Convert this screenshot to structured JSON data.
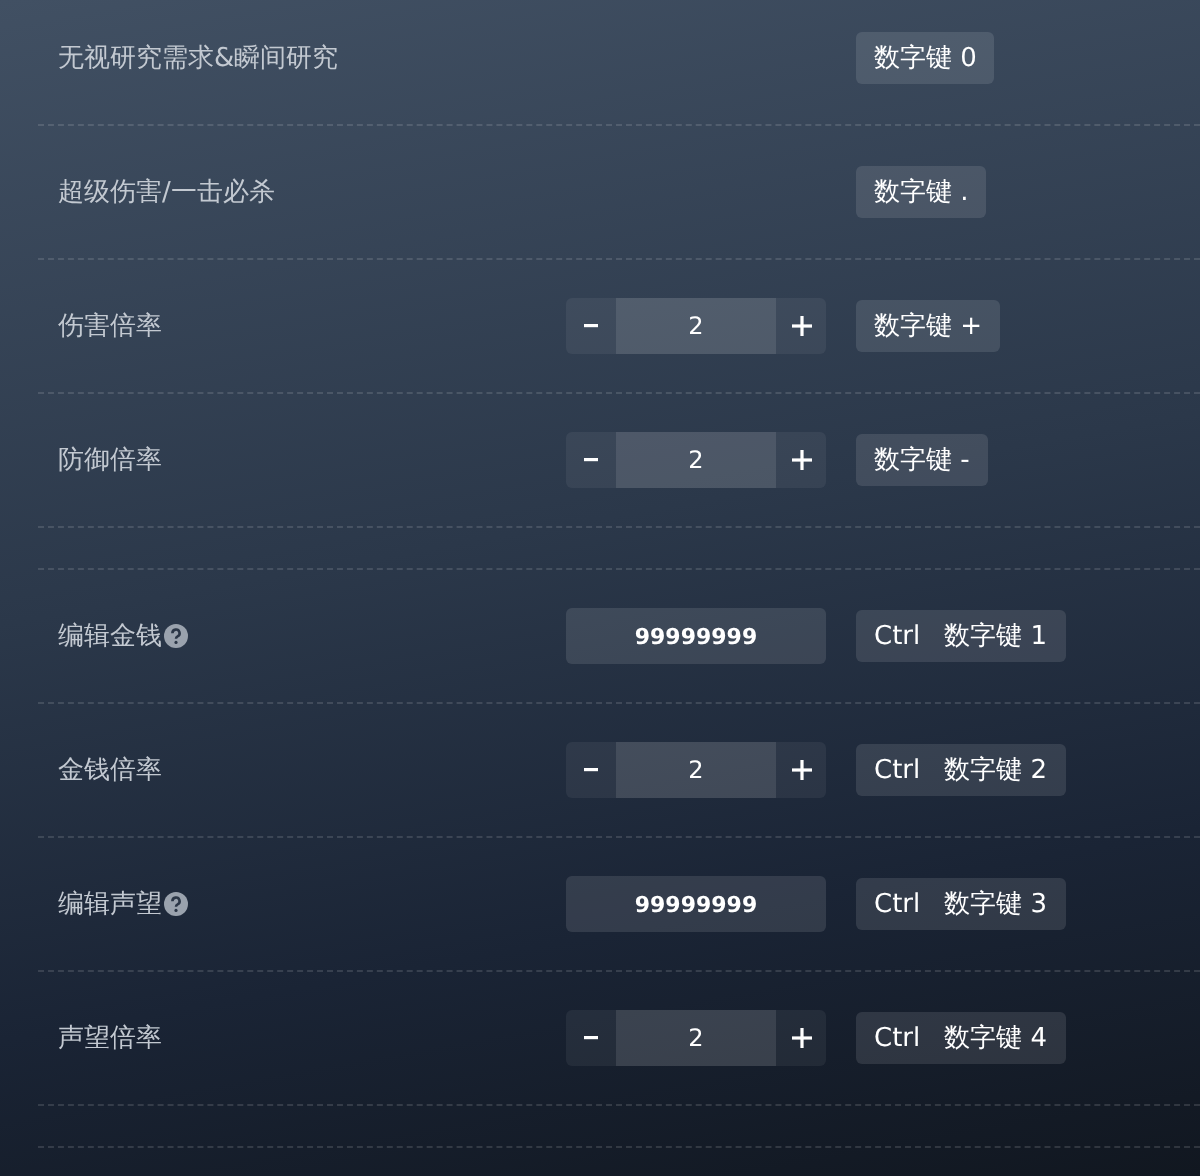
{
  "sections": [
    {
      "rows": [
        {
          "label": "无视研究需求&瞬间研究",
          "kind": "plain",
          "keys": [
            "数字键 0"
          ]
        },
        {
          "label": "超级伤害/一击必杀",
          "kind": "plain",
          "keys": [
            "数字键 ."
          ]
        },
        {
          "label": "伤害倍率",
          "kind": "stepper",
          "value": "2",
          "keys": [
            "数字键 +"
          ]
        },
        {
          "label": "防御倍率",
          "kind": "stepper",
          "value": "2",
          "keys": [
            "数字键 -"
          ]
        }
      ]
    },
    {
      "rows": [
        {
          "label": "编辑金钱",
          "kind": "input",
          "help": true,
          "value": "99999999",
          "keys": [
            "Ctrl",
            "数字键 1"
          ]
        },
        {
          "label": "金钱倍率",
          "kind": "stepper",
          "value": "2",
          "keys": [
            "Ctrl",
            "数字键 2"
          ]
        },
        {
          "label": "编辑声望",
          "kind": "input",
          "help": true,
          "value": "99999999",
          "keys": [
            "Ctrl",
            "数字键 3"
          ]
        },
        {
          "label": "声望倍率",
          "kind": "stepper",
          "value": "2",
          "keys": [
            "Ctrl",
            "数字键 4"
          ]
        }
      ]
    }
  ]
}
